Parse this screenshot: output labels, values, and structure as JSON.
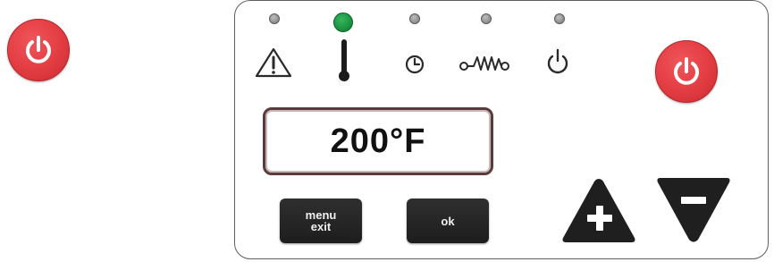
{
  "display": {
    "temperature": "200°F"
  },
  "buttons": {
    "menu_line1": "menu",
    "menu_line2": "exit",
    "ok": "ok"
  },
  "indicators": [
    {
      "icon": "warning-icon",
      "active": false
    },
    {
      "icon": "thermometer-icon",
      "active": true
    },
    {
      "icon": "clock-icon",
      "active": false
    },
    {
      "icon": "heating-element-icon",
      "active": false
    },
    {
      "icon": "power-icon",
      "active": false
    }
  ],
  "colors": {
    "power_red": "#e23c41",
    "active_led_green": "#148a3a",
    "inactive_led_gray": "#8d8d8d",
    "key_dark": "#242424"
  }
}
